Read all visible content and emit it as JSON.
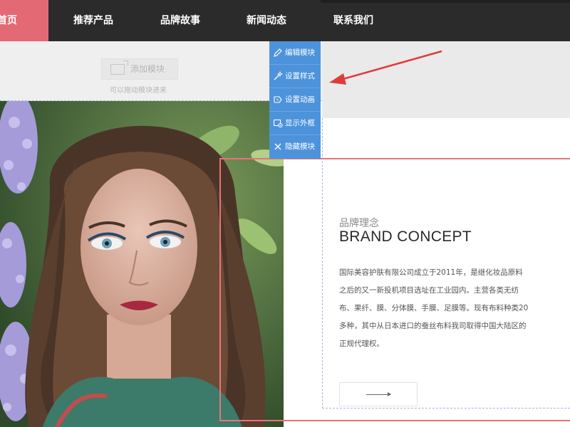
{
  "nav": {
    "items": [
      {
        "label": "首页",
        "active": true
      },
      {
        "label": "推荐产品",
        "active": false
      },
      {
        "label": "品牌故事",
        "active": false
      },
      {
        "label": "新闻动态",
        "active": false
      },
      {
        "label": "联系我们",
        "active": false
      }
    ],
    "active_color": "#e36a74",
    "background_color": "#2b2b2b"
  },
  "add_module": {
    "button_label": "添加模块",
    "hint": "可以拖动模块进来",
    "icon": "placeholder-image-icon"
  },
  "toolbar": {
    "background_color": "#4d93db",
    "items": [
      {
        "label": "编辑模块",
        "icon": "pencil-icon"
      },
      {
        "label": "设置样式",
        "icon": "magic-wand-icon"
      },
      {
        "label": "设置动画",
        "icon": "animation-icon"
      },
      {
        "label": "显示外框",
        "icon": "frame-eye-icon"
      },
      {
        "label": "隐藏模块",
        "icon": "close-icon"
      }
    ]
  },
  "content": {
    "subtitle": "品牌理念",
    "title": "BRAND CONCEPT",
    "description": "国际美容护肤有限公司成立于2011年，是继化妆品原料之后的又一新投机项目选址在工业园内。主营各类无纺布、果纤、膜、分体膜、手膜、足膜等。现有布料种类20多种，其中从日本进口的蚕丝布料我司取得中国大陆区的正规代理权。",
    "more_icon": "long-arrow-right-icon"
  },
  "selection_frame_color": "#e9737b",
  "annotation_arrow_color": "#e03b3b"
}
